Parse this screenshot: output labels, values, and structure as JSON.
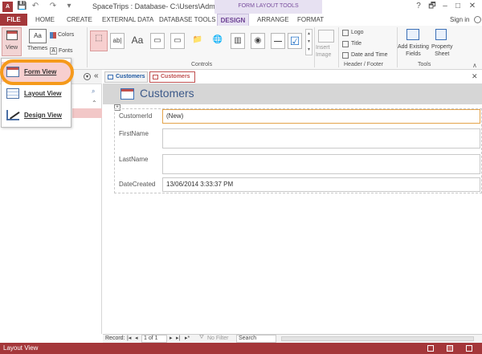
{
  "title_bar": {
    "app_badge": "A",
    "window_title": "SpaceTrips : Database- C:\\Users\\Administra...",
    "context_tools": "FORM LAYOUT TOOLS",
    "win_controls": [
      "?",
      "🗗",
      "–",
      "□",
      "✕"
    ]
  },
  "tabs": {
    "file": "FILE",
    "home": "HOME",
    "create": "CREATE",
    "external": "EXTERNAL DATA",
    "dbtools": "DATABASE TOOLS",
    "design": "DESIGN",
    "arrange": "ARRANGE",
    "format": "FORMAT",
    "signin": "Sign in"
  },
  "ribbon": {
    "view": "View",
    "themes": "Themes",
    "colors": "Colors",
    "fonts": "Fonts",
    "controls_label": "Controls",
    "insert_image": "Insert\nImage",
    "logo": "Logo",
    "title": "Title",
    "date_time": "Date and Time",
    "header_footer_label": "Header / Footer",
    "add_fields": "Add Existing\nFields",
    "property_sheet": "Property\nSheet",
    "tools_label": "Tools",
    "control_glyphs": [
      "⬚",
      "ab|",
      "Aa",
      "▭",
      "▭",
      "📁",
      "🌐",
      "▥",
      "◉",
      "☑"
    ]
  },
  "nav": {
    "collapse": "«"
  },
  "doc": {
    "tab1": "Customers",
    "tab2": "Customers",
    "form_title": "Customers",
    "labels": {
      "customer_id": "CustomerId",
      "first_name": "FirstName",
      "last_name": "LastName",
      "date_created": "DateCreated"
    },
    "values": {
      "customer_id": "(New)",
      "first_name": "",
      "last_name": "",
      "date_created": "13/06/2014 3:33:37 PM"
    }
  },
  "record_bar": {
    "record": "Record:",
    "pos": "1 of 1",
    "no_filter": "No Filter",
    "search": "Search"
  },
  "status": {
    "left": "Layout View"
  },
  "view_menu": {
    "items": [
      "Form View",
      "Layout View",
      "Design View"
    ]
  }
}
